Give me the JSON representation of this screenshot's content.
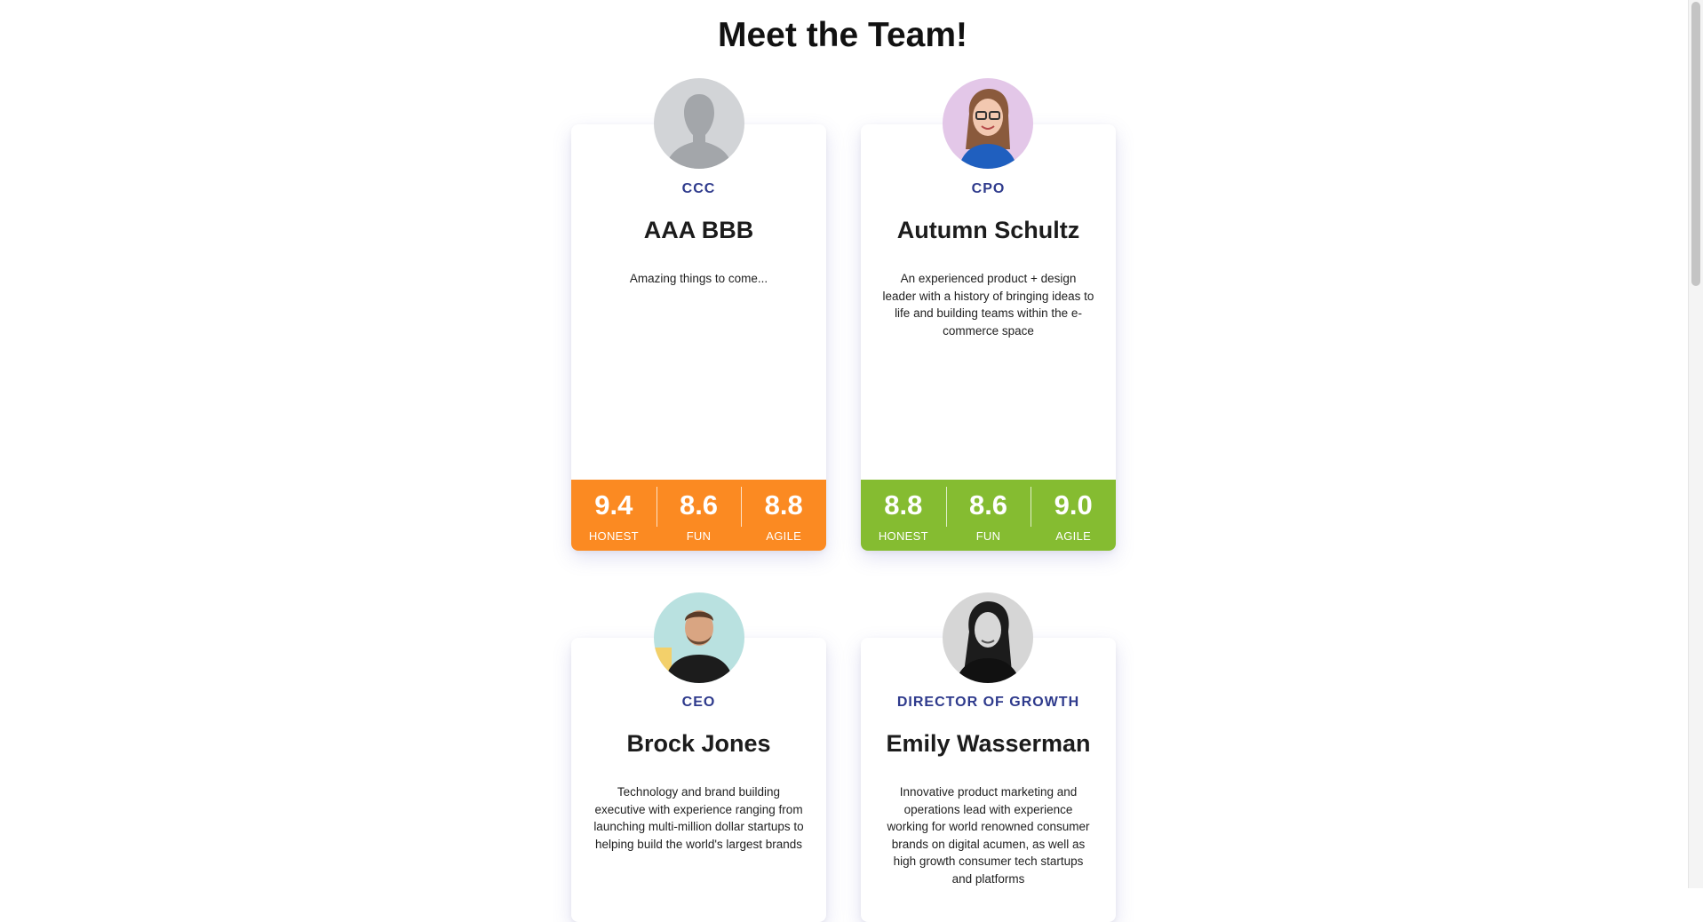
{
  "page": {
    "title": "Meet the Team!"
  },
  "colors": {
    "orange": "#fb8a22",
    "green": "#85bc31",
    "role_text": "#2e3a8c"
  },
  "stat_labels": {
    "honest": "HONEST",
    "fun": "FUN",
    "agile": "AGILE"
  },
  "team": [
    {
      "role": "CCC",
      "name": "AAA BBB",
      "bio": "Amazing things to come...",
      "avatar_icon": "person-silhouette-icon",
      "stats_color": "#fb8a22",
      "stats": {
        "honest": "9.4",
        "fun": "8.6",
        "agile": "8.8"
      }
    },
    {
      "role": "CPO",
      "name": "Autumn Schultz",
      "bio": "An experienced product + design leader with a history of bringing ideas to life and building teams within the e-commerce space",
      "avatar_icon": "portrait-photo-icon",
      "stats_color": "#85bc31",
      "stats": {
        "honest": "8.8",
        "fun": "8.6",
        "agile": "9.0"
      }
    },
    {
      "role": "CEO",
      "name": "Brock Jones",
      "bio": "Technology and brand building executive with experience ranging from launching multi-million dollar startups to helping build the world's largest brands",
      "avatar_icon": "portrait-photo-icon"
    },
    {
      "role": "DIRECTOR OF GROWTH",
      "name": "Emily Wasserman",
      "bio": "Innovative product marketing and operations lead with experience working for world renowned consumer brands on digital acumen, as well as high growth consumer tech startups and platforms",
      "avatar_icon": "portrait-photo-icon"
    }
  ]
}
